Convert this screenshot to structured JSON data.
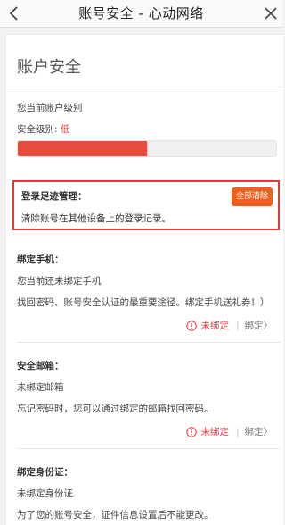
{
  "header": {
    "title": "账号安全 - 心动网络"
  },
  "page": {
    "title": "账户安全"
  },
  "level": {
    "label": "您当前账户级别",
    "prefix": "安全级别:",
    "value": "低",
    "progress_fraction": 0.5
  },
  "footprint": {
    "title": "登录足迹管理：",
    "button_label": "全部清除",
    "description": "清除账号在其他设备上的登录记录。"
  },
  "phone": {
    "title": "绑定手机：",
    "status_text": "您当前还未绑定手机",
    "description": "找回密码、账号安全认证的最重要途径。绑定手机送礼券！）",
    "status_label": "未绑定",
    "action_label": "绑定〉"
  },
  "email": {
    "title": "安全邮箱：",
    "status_text": "未绑定邮箱",
    "description": "忘记密码时，您可以通过绑定的邮箱找回密码。",
    "status_label": "未绑定",
    "action_label": "绑定〉"
  },
  "id_card": {
    "title": "绑定身份证：",
    "status_text": "未绑定身份证",
    "description": "为了您的账号安全，证件信息设置后不能更改。"
  },
  "icons": {
    "back": "chevron-left-icon",
    "close": "close-icon",
    "warning": "exclamation-circle-icon"
  },
  "colors": {
    "accent_red": "#e4393c",
    "progress_fill": "#e84c3d",
    "button_orange": "#f0601c"
  }
}
